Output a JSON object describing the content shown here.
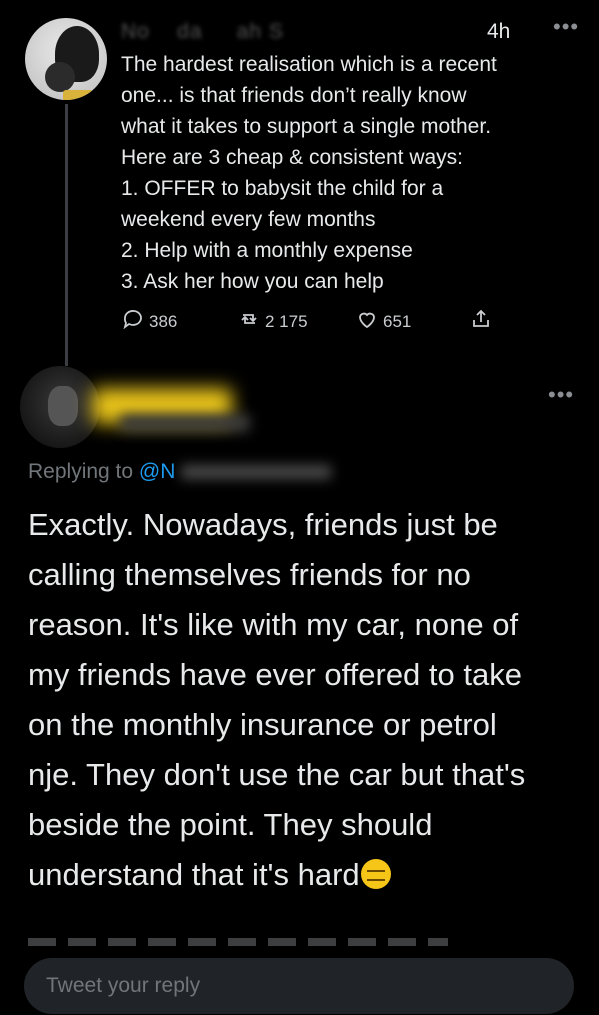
{
  "parent_tweet": {
    "time": "4h",
    "more": "•••",
    "lines": [
      "The hardest realisation which is a recent",
      "one... is that friends don’t really know",
      "what it takes to support a single mother.",
      "Here are 3 cheap & consistent ways:",
      "1. OFFER to babysit the child for a",
      "weekend every few months",
      "2. Help with a monthly expense",
      "3. Ask her how you can help"
    ],
    "replies": "386",
    "retweets": "2 175",
    "likes": "651"
  },
  "reply_tweet": {
    "more": "•••",
    "replying_prefix": "Replying to",
    "replying_handle": "@N",
    "lines": [
      "Exactly. Nowadays, friends just be",
      "calling themselves friends for no",
      "reason. It's like with my car, none of",
      "my friends have ever offered to take",
      "on the monthly insurance or petrol",
      "nje. They don't use the car but that's",
      "beside the point. They should",
      "understand that it's hard"
    ],
    "emoji": "expressionless-face"
  },
  "composer": {
    "placeholder": "Tweet your reply"
  },
  "colors": {
    "background": "#000000",
    "text": "#e7e9ea",
    "muted": "#71767b",
    "link": "#1d9bf0",
    "input_bg": "#202327"
  }
}
